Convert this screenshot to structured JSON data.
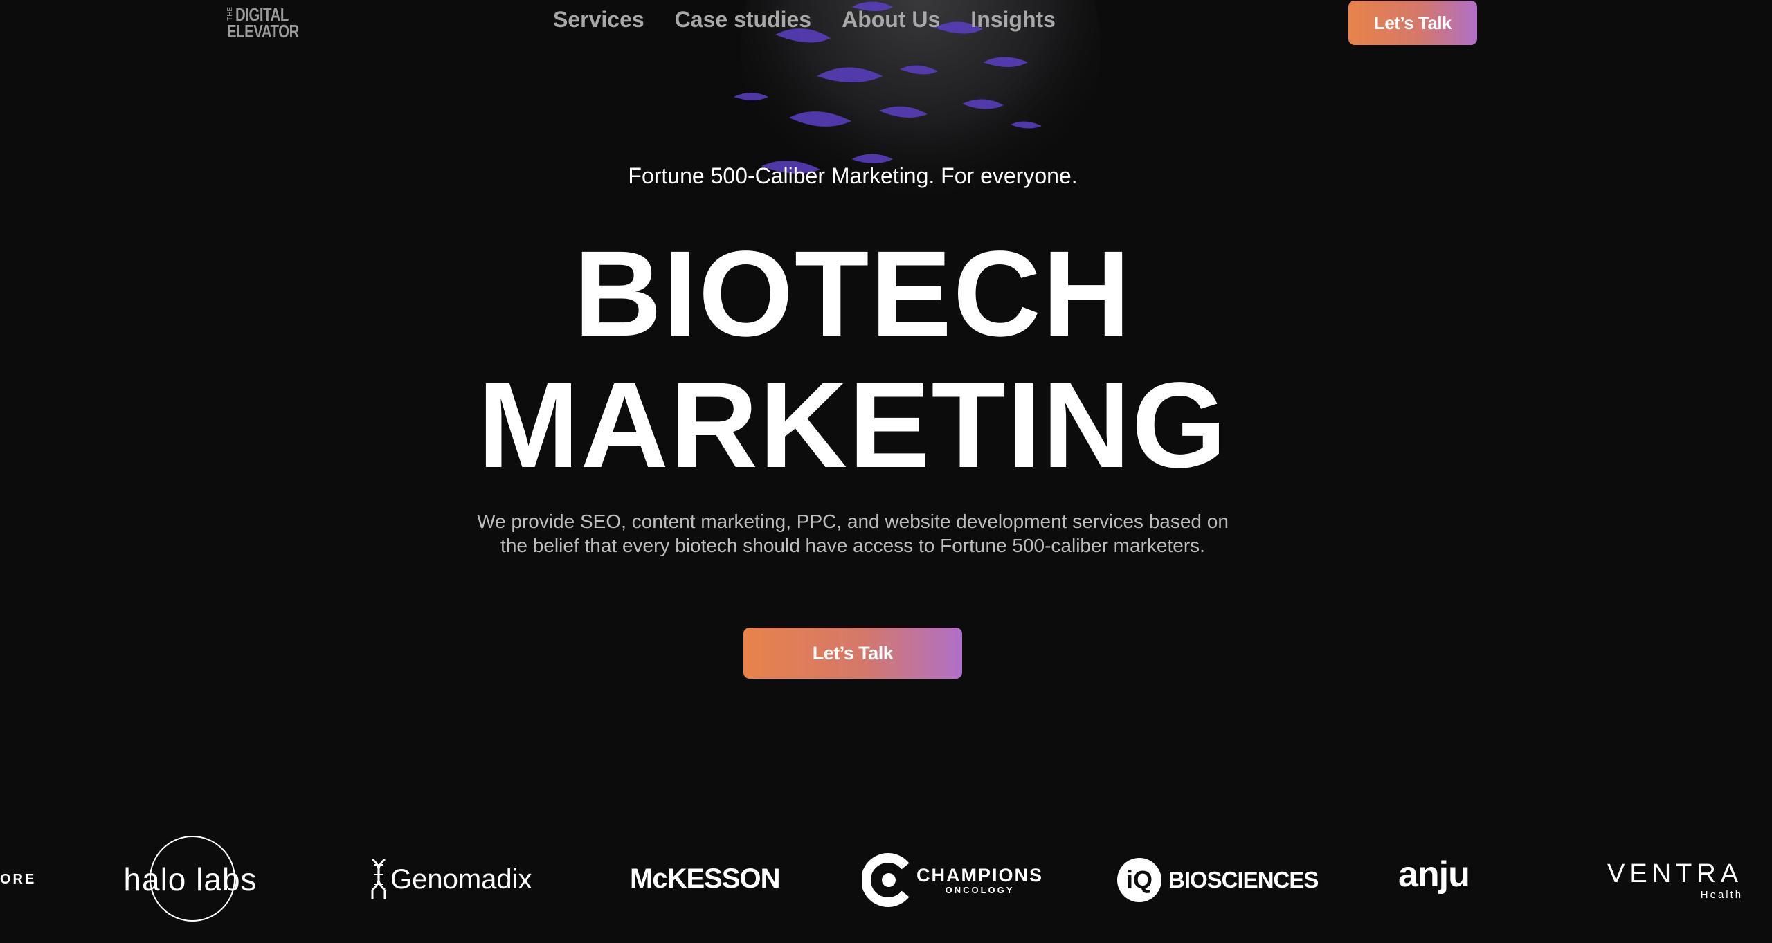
{
  "header": {
    "logo_the": "THE",
    "logo_line1": "DIGITAL",
    "logo_line2": "ELEVATOR",
    "nav": [
      {
        "label": "Services"
      },
      {
        "label": "Case studies"
      },
      {
        "label": "About Us"
      },
      {
        "label": "Insights"
      }
    ],
    "cta_label": "Let’s Talk"
  },
  "hero": {
    "tagline": "Fortune 500-Caliber Marketing. For everyone.",
    "headline_line1": "BIOTECH",
    "headline_line2": "MARKETING",
    "description": "We provide SEO, content marketing, PPC, and website development services based on the belief that every biotech should have access to Fortune 500-caliber marketers.",
    "cta_label": "Let’s Talk"
  },
  "clients": {
    "partial": "ORE",
    "halo": "halo labs",
    "genomadix": "Genomadix",
    "mckesson": "McKESSON",
    "champions_main": "CHAMPIONS",
    "champions_sub": "ONCOLOGY",
    "iq_badge": "iQ",
    "iq_text": "BIOSCIENCES",
    "anju": "anju",
    "ventra_main": "VENTRA",
    "ventra_sub": "Health"
  },
  "colors": {
    "background": "#0c0c0d",
    "cta_gradient_start": "#e8834a",
    "cta_gradient_end": "#b070c8",
    "accent_purple": "#6a4bd0"
  }
}
